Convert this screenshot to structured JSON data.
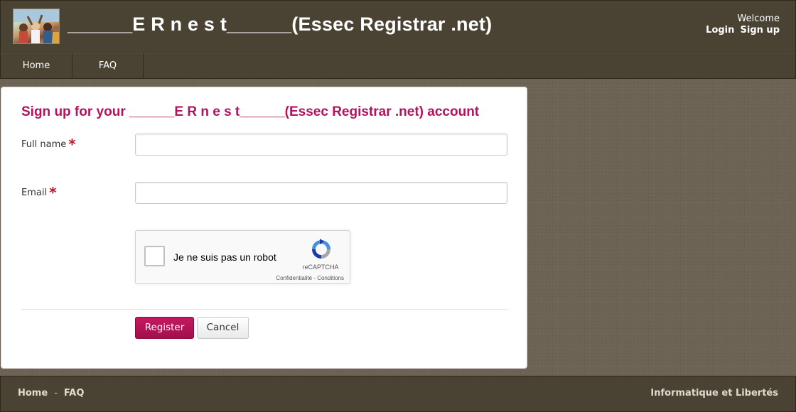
{
  "header": {
    "site_title": "______E R n e s t______(Essec Registrar .net)",
    "welcome": "Welcome",
    "login_label": "Login",
    "signup_label": "Sign up"
  },
  "nav": {
    "items": [
      {
        "label": "Home"
      },
      {
        "label": "FAQ"
      }
    ]
  },
  "form": {
    "heading": "Sign up for your ______E R n e s t______(Essec Registrar .net) account",
    "full_name_label": "Full name",
    "email_label": "Email",
    "required_marker": "*",
    "full_name_value": "",
    "email_value": "",
    "register_label": "Register",
    "cancel_label": "Cancel"
  },
  "captcha": {
    "label": "Je ne suis pas un robot",
    "brand": "reCAPTCHA",
    "privacy": "Confidentialité",
    "terms_sep": " - ",
    "terms": "Conditions",
    "icon": "recaptcha-icon"
  },
  "footer": {
    "home_label": "Home",
    "separator": "-",
    "faq_label": "FAQ",
    "legal_label": "Informatique et Libertés"
  },
  "colors": {
    "header_bg": "#4a4233",
    "accent": "#b5115c",
    "register_bg": "#b0134f",
    "required": "#c0122c"
  }
}
